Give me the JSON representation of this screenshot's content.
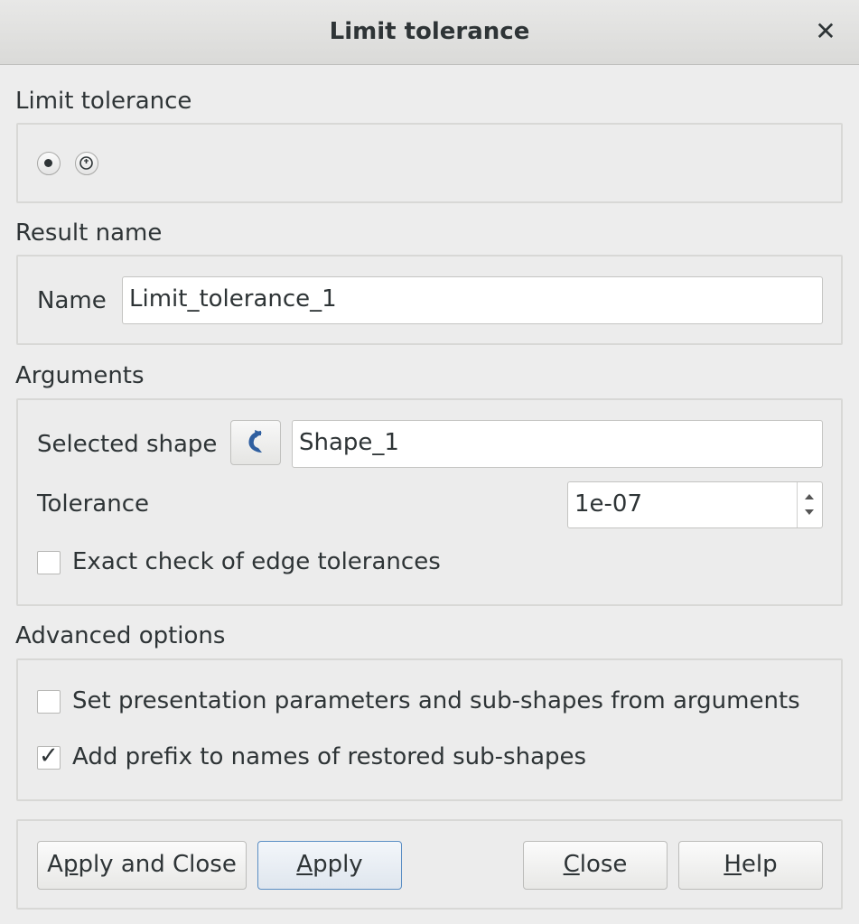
{
  "window": {
    "title": "Limit tolerance",
    "close_icon": "close-icon"
  },
  "limit_group": {
    "label": "Limit tolerance",
    "selected_index": 0
  },
  "result_group": {
    "label": "Result name",
    "name_label": "Name",
    "name_value": "Limit_tolerance_1"
  },
  "arguments_group": {
    "label": "Arguments",
    "selected_shape_label": "Selected shape",
    "selected_shape_value": "Shape_1",
    "tolerance_label": "Tolerance",
    "tolerance_value": "1e-07",
    "exact_check_label": "Exact check of edge tolerances",
    "exact_check_checked": false
  },
  "advanced_group": {
    "label": "Advanced options",
    "presentation_label": "Set presentation parameters and sub-shapes from arguments",
    "presentation_checked": false,
    "prefix_label": "Add prefix to names of restored sub-shapes",
    "prefix_checked": true
  },
  "buttons": {
    "apply_close": {
      "pre": "A",
      "mnemonic": "p",
      "post": "ply and Close"
    },
    "apply": {
      "pre": "",
      "mnemonic": "A",
      "post": "pply"
    },
    "close": {
      "pre": "",
      "mnemonic": "C",
      "post": "lose"
    },
    "help": {
      "pre": "",
      "mnemonic": "H",
      "post": "elp"
    }
  },
  "colors": {
    "accent": "#5b8ec4",
    "select_arrow": "#2f5fa0",
    "background": "#ededed"
  }
}
